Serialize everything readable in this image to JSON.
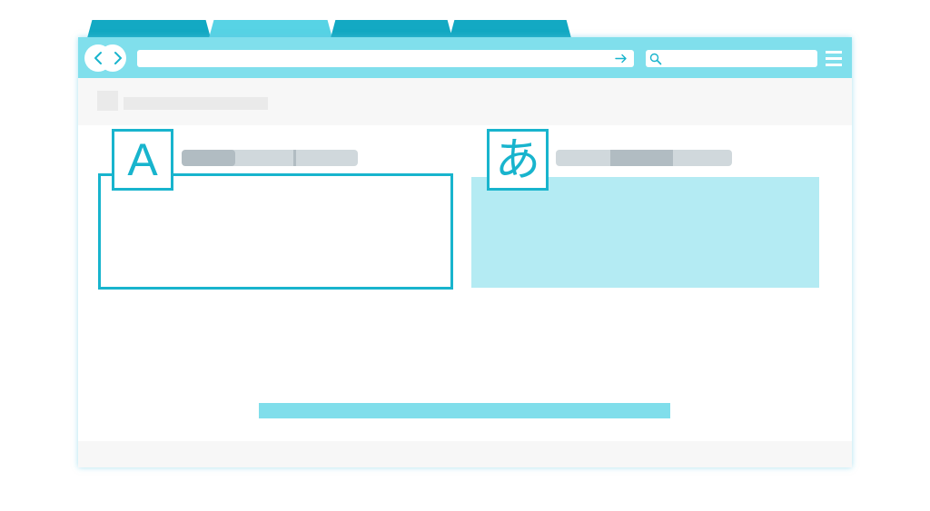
{
  "colors": {
    "tab_dark": "#13a9c3",
    "tab_light": "#57d3e5",
    "toolbar": "#80dfec",
    "accent": "#18b4cd",
    "target_fill": "#b4ebf3",
    "button": "#80deeb"
  },
  "browser": {
    "back_icon": "chevron-left-icon",
    "forward_icon": "chevron-right-icon",
    "go_icon": "arrow-right-icon",
    "search_icon": "search-icon",
    "menu_icon": "hamburger-menu-icon"
  },
  "translator": {
    "source": {
      "glyph": "A"
    },
    "target": {
      "glyph": "あ"
    }
  }
}
